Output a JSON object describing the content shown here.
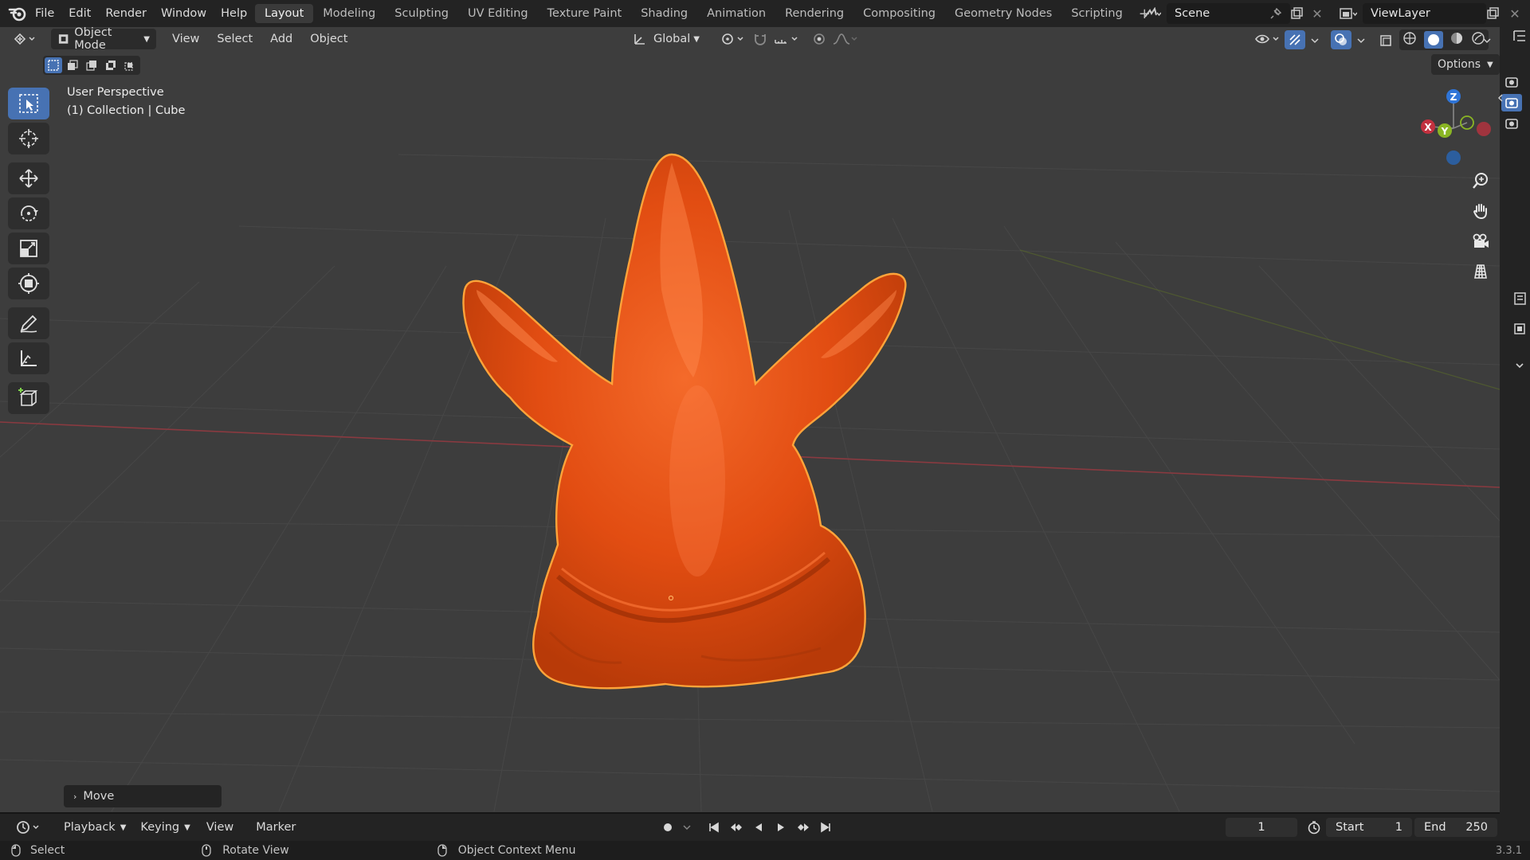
{
  "app": {
    "logo": "blender-icon"
  },
  "menu": [
    "File",
    "Edit",
    "Render",
    "Window",
    "Help"
  ],
  "workspaces": [
    "Layout",
    "Modeling",
    "Sculpting",
    "UV Editing",
    "Texture Paint",
    "Shading",
    "Animation",
    "Rendering",
    "Compositing",
    "Geometry Nodes",
    "Scripting"
  ],
  "active_workspace": "Layout",
  "scene": {
    "label": "Scene"
  },
  "view_layer": {
    "label": "ViewLayer"
  },
  "viewport_header": {
    "mode": "Object Mode",
    "menus": [
      "View",
      "Select",
      "Add",
      "Object"
    ],
    "transform_orientation": "Global",
    "options_label": "Options"
  },
  "viewport": {
    "perspective": "User Perspective",
    "collection_info": "(1) Collection | Cube",
    "last_operator": "Move",
    "gizmo_axes": {
      "z": "Z",
      "y": "Y",
      "x": "X"
    }
  },
  "object": {
    "name": "Cube",
    "color": "#e24d12",
    "outline": "#ffa43a"
  },
  "timeline": {
    "menus": [
      "Playback",
      "Keying",
      "View",
      "Marker"
    ],
    "current_frame": "1",
    "start_label": "Start",
    "start": "1",
    "end_label": "End",
    "end": "250"
  },
  "statusbar": {
    "select": "Select",
    "rotate": "Rotate View",
    "context": "Object Context Menu",
    "version": "3.3.1"
  },
  "colors": {
    "accent": "#4772b3",
    "x_axis": "#c2313f",
    "y_axis": "#8ab524",
    "z_axis": "#2f75d8"
  }
}
